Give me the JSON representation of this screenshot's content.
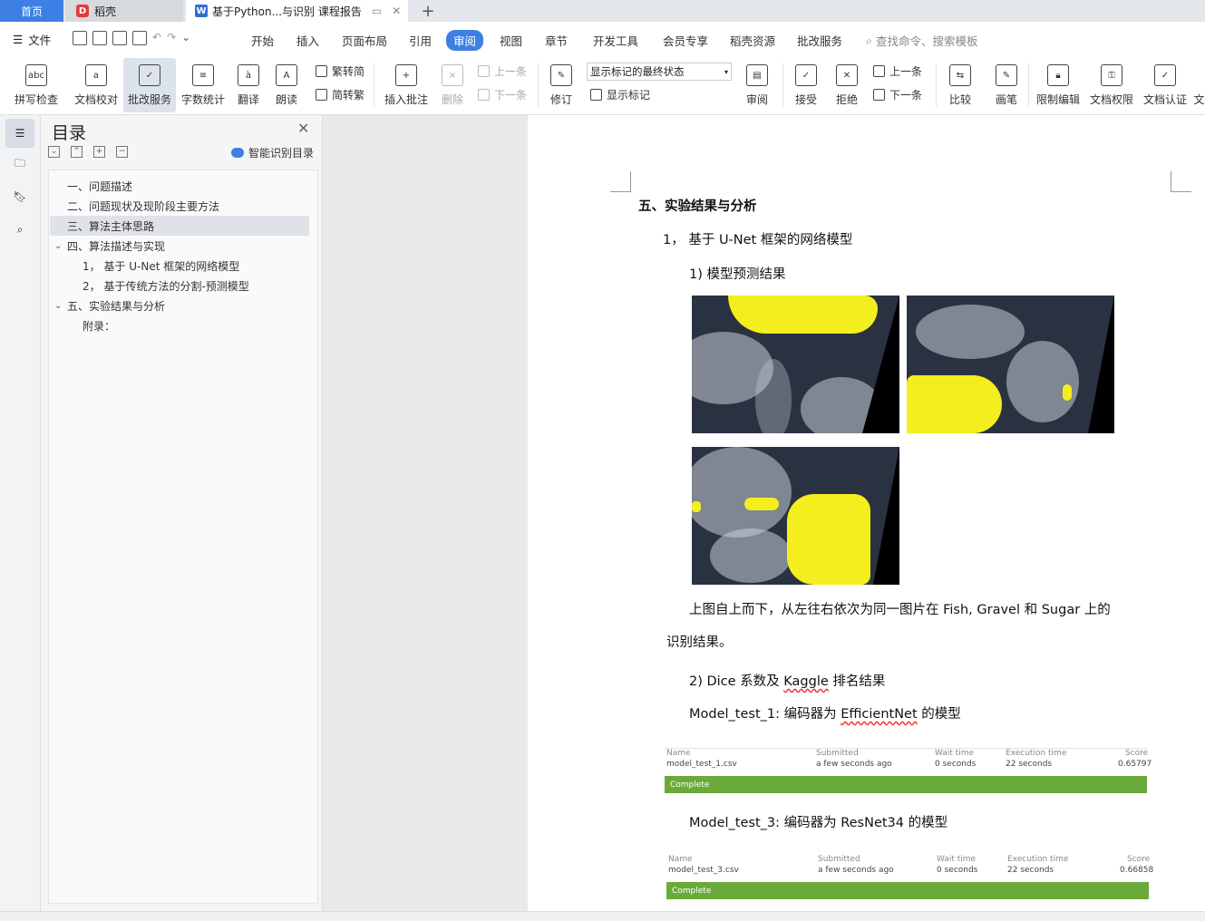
{
  "tabs": {
    "home": "首页",
    "daoke": "稻壳",
    "doc": "基于Python...与识别 课程报告"
  },
  "menu": {
    "file": "文件",
    "items": [
      "开始",
      "插入",
      "页面布局",
      "引用",
      "审阅",
      "视图",
      "章节",
      "开发工具",
      "会员专享",
      "稻壳资源",
      "批改服务"
    ],
    "active": "审阅",
    "search_placeholder": "查找命令、搜索模板"
  },
  "ribbon": {
    "spell": "拼写检查",
    "proof": "文档校对",
    "correction": "批改服务",
    "wordcount": "字数统计",
    "translate": "翻译",
    "read": "朗读",
    "trad": "繁转简",
    "simp": "简转繁",
    "insert_comment": "插入批注",
    "delete": "删除",
    "prev": "上一条",
    "next": "下一条",
    "revise": "修订",
    "markup_state": "显示标记的最终状态",
    "show_markup": "显示标记",
    "review": "审阅",
    "accept": "接受",
    "reject": "拒绝",
    "prev2": "上一条",
    "next2": "下一条",
    "compare": "比较",
    "pen": "画笔",
    "restrict": "限制编辑",
    "permission": "文档权限",
    "certify": "文档认证",
    "more": "文"
  },
  "toc": {
    "title": "目录",
    "smart": "智能识别目录",
    "items": [
      "一、问题描述",
      "二、问题现状及现阶段主要方法",
      "三、算法主体思路",
      "四、算法描述与实现",
      "1， 基于 U-Net 框架的网络模型",
      "2， 基于传统方法的分割-预测模型",
      "五、实验结果与分析",
      "附录："
    ]
  },
  "document": {
    "heading": "五、实验结果与分析",
    "sub1": "1，  基于 U-Net 框架的网络模型",
    "sub1a": "1)   模型预测结果",
    "caption_line1": "上图自上而下，从左往右依次为同一图片在 Fish, Gravel 和 Sugar 上的",
    "caption_line2": "识别结果。",
    "sub2_prefix": "2)   Dice 系数及 ",
    "sub2_kaggle": "Kaggle",
    "sub2_suffix": " 排名结果",
    "model1_prefix": "Model_test_1: 编码器为 ",
    "model1_name": "EfficientNet",
    "model1_suffix": " 的模型",
    "model3": "Model_test_3: 编码器为 ResNet34 的模型"
  },
  "leaderboard": {
    "headers": [
      "Name",
      "Submitted",
      "Wait time",
      "Execution time",
      "Score"
    ],
    "rows": [
      {
        "name": "model_test_1.csv",
        "submitted": "a few seconds ago",
        "wait": "0 seconds",
        "exec": "22 seconds",
        "score": "0.65797",
        "status": "Complete"
      },
      {
        "name": "model_test_3.csv",
        "submitted": "a few seconds ago",
        "wait": "0 seconds",
        "exec": "22 seconds",
        "score": "0.66858",
        "status": "Complete"
      }
    ]
  },
  "colors": {
    "accent": "#3d7fe3",
    "mask": "#f4ee1e",
    "complete": "#6aaa3a"
  }
}
